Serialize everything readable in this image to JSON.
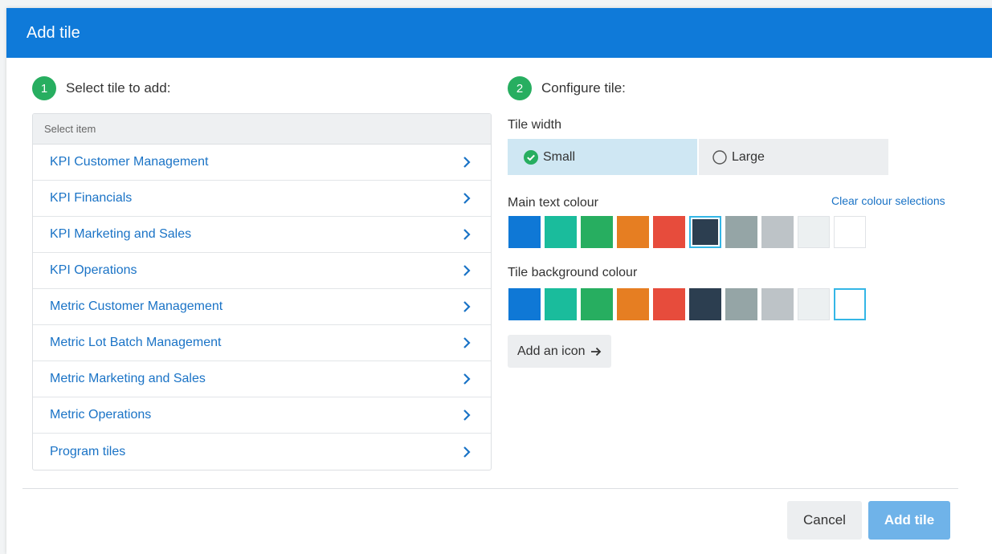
{
  "dialog": {
    "title": "Add tile"
  },
  "step1": {
    "number": "1",
    "label": "Select tile to add:"
  },
  "step2": {
    "number": "2",
    "label": "Configure tile:"
  },
  "list": {
    "header": "Select item",
    "items": [
      "KPI Customer Management",
      "KPI Financials",
      "KPI Marketing and Sales",
      "KPI Operations",
      "Metric Customer Management",
      "Metric Lot Batch Management",
      "Metric Marketing and Sales",
      "Metric Operations",
      "Program tiles"
    ]
  },
  "config": {
    "tile_width_label": "Tile width",
    "width_options": {
      "small": "Small",
      "large": "Large",
      "selected": "small"
    },
    "main_text_label": "Main text colour",
    "clear_colours": "Clear colour selections",
    "background_label": "Tile background colour",
    "add_icon": "Add an icon"
  },
  "palette": [
    "#0f78d6",
    "#1abc9c",
    "#27ae60",
    "#e67e22",
    "#e74c3c",
    "#2c3e50",
    "#95a5a6",
    "#bdc3c7",
    "#ecf0f1",
    "#ffffff"
  ],
  "main_text_selected": 5,
  "background_selected": 9,
  "footer": {
    "cancel": "Cancel",
    "add": "Add tile"
  },
  "colors": {
    "header": "#0f7ad9",
    "step_badge": "#27ae60",
    "link": "#1a73c6",
    "selected_outline": "#34b6e6",
    "primary_button": "#6fb3e9"
  },
  "icons": {
    "list_item": "chevron-right-icon",
    "small_option": "check-circle-icon",
    "large_option": "radio-empty-icon",
    "add_icon_button": "arrow-right-icon"
  }
}
